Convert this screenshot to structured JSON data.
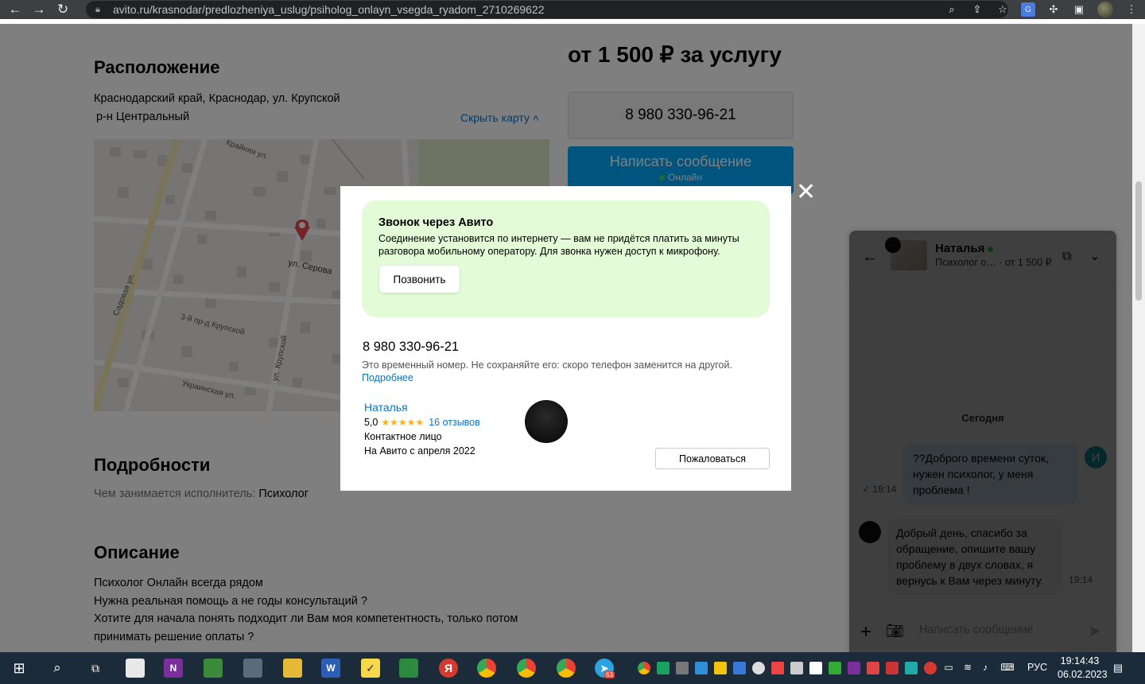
{
  "browser": {
    "url": "avito.ru/krasnodar/predlozheniya_uslug/psiholog_onlayn_vsegda_ryadom_2710269622"
  },
  "page": {
    "location_title": "Расположение",
    "address_line1": "Краснодарский край, Краснодар, ул. Крупской",
    "address_line2": "р-н Центральный",
    "hide_map": "Скрыть карту",
    "map_streets": [
      "Крайняя ул.",
      "ул. Серова",
      "Садовая ул.",
      "3-й пр-д Крупской",
      "ул. Крупской",
      "Украинская ул."
    ],
    "price": "от 1 500 ₽ за услугу",
    "phone_button": "8 980 330-96-21",
    "message_button": "Написать сообщение",
    "message_status": "Онлайн",
    "details_title": "Подробности",
    "details_key": "Чем занимается исполнитель:",
    "details_value": "Психолог",
    "description_title": "Описание",
    "description_lines": [
      "Психолог Онлайн всегда рядом",
      "Нужна реальная помощь а не годы консультаций ?",
      "Хотите для начала понять подходит ли Вам моя компетентность, только потом",
      "принимать решение оплаты ?"
    ]
  },
  "modal": {
    "call_title": "Звонок через Авито",
    "call_desc": "Соединение установится по интернету — вам не придётся платить за минуты разговора мобильному оператору. Для звонка нужен доступ к микрофону.",
    "call_button": "Позвонить",
    "phone": "8 980 330-96-21",
    "note": "Это временный номер. Не сохраняйте его: скоро телефон заменится на другой.",
    "more": "Подробнее",
    "seller_name": "Наталья",
    "rating": "5,0",
    "stars": "★★★★★",
    "reviews": "16 отзывов",
    "role": "Контактное лицо",
    "since": "На Авито с апреля 2022",
    "complain": "Пожаловаться"
  },
  "chat": {
    "name": "Наталья",
    "subtitle": "Психолог о…",
    "price": "от 1 500 ₽",
    "date_divider": "Сегодня",
    "out_message": "??Доброго времени суток, нужен психолог, у меня проблема !",
    "out_time": "19:14",
    "my_avatar_letter": "И",
    "in_message": "Добрый день, спасибо за обращение, опишите вашу проблему в двух словах, я вернусь к Вам через минуту.",
    "in_time": "19:14",
    "input_placeholder": "Написать сообщение"
  },
  "taskbar": {
    "lang": "РУС",
    "time": "19:14:43",
    "date": "06.02.2023",
    "telegram_badge": "63"
  },
  "colors": {
    "link": "#0a74c4",
    "accent_blue": "#00aaff",
    "green_box": "#e3fcd7",
    "online": "#45d35c"
  }
}
